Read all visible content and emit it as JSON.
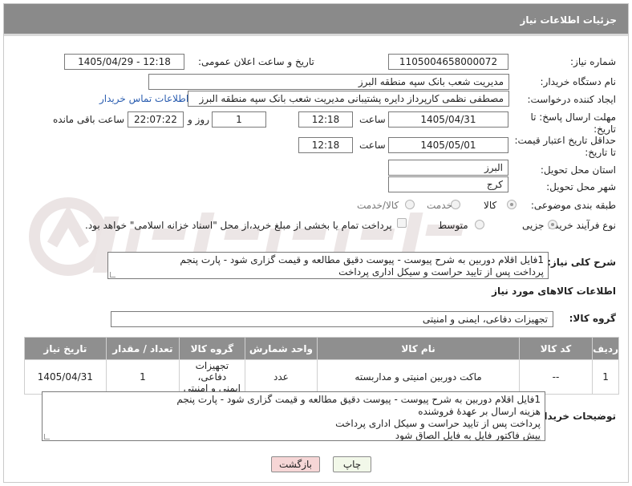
{
  "panel": {
    "title": "جزئیات اطلاعات نیاز"
  },
  "fields": {
    "need_number_label": "شماره نیاز:",
    "need_number": "1105004658000072",
    "announce_label": "تاریخ و ساعت اعلان عمومی:",
    "announce_value": "1405/04/29 - 12:18",
    "buyer_label": "نام دستگاه خریدار:",
    "buyer_value": "مدیریت شعب بانک سپه منطقه البرز",
    "requester_label": "ایجاد کننده درخواست:",
    "requester_value": "مصطفی نظمی کارپرداز دایره پشتیبانی مدیریت شعب بانک سپه منطقه البرز",
    "contact_link": "اطلاعات تماس خریدار",
    "deadline_label": "مهلت ارسال پاسخ: تا تاریخ:",
    "deadline_date": "1405/04/31",
    "time_label": "ساعت",
    "deadline_time": "12:18",
    "days_value": "1",
    "days_label": "روز و",
    "remaining_value": "22:07:22",
    "remaining_label": "ساعت باقی مانده",
    "validity_label": "حداقل تاریخ اعتبار قیمت: تا تاریخ:",
    "validity_date": "1405/05/01",
    "validity_time": "12:18",
    "province_label": "استان محل تحویل:",
    "province_value": "البرز",
    "city_label": "شهر محل تحویل:",
    "city_value": "کرج",
    "category_label": "طبقه بندی موضوعی:",
    "category_options": [
      "کالا",
      "خدمت",
      "کالا/خدمت"
    ],
    "category_selected": "کالا",
    "process_label": "نوع فرآیند خرید :",
    "process_options": [
      "جزیی",
      "متوسط"
    ],
    "process_selected": "جزیی",
    "payment_note": "پرداخت تمام یا بخشی از مبلغ خرید،از محل \"اسناد خزانه اسلامی\" خواهد بود.",
    "summary_label": "شرح کلی نیاز:",
    "summary_line1": "1فایل اقلام دوربین به شرح پیوست - پیوست دقیق مطالعه و قیمت گزاری شود - پارت پنجم",
    "summary_line2": "پرداخت پس از تایید حراست و سیکل اداری پرداخت"
  },
  "goods": {
    "section_title": "اطلاعات کالاهای مورد نیاز",
    "group_label": "گروه کالا:",
    "group_value": "تجهیزات دفاعی، ایمنی و امنیتی",
    "columns": [
      "ردیف",
      "کد کالا",
      "نام کالا",
      "واحد شمارش",
      "گروه کالا",
      "تعداد / مقدار",
      "تاریخ نیاز"
    ],
    "rows": [
      {
        "row": "1",
        "code": "--",
        "name": "ماکت دوربین امنیتی و مداربسته",
        "unit": "عدد",
        "group_line1": "تجهیزات دفاعی،",
        "group_line2": "ایمنی و امنیتی",
        "qty": "1",
        "date": "1405/04/31"
      }
    ]
  },
  "buyer_notes": {
    "label": "توضیحات خریدار:",
    "lines": [
      "1فایل اقلام دوربین به شرح پیوست - پیوست دقیق مطالعه و قیمت گزاری شود - پارت پنجم",
      "هزینه ارسال بر عهدهٔ فروشنده",
      "پرداخت پس از تایید حراست و سیکل اداری پرداخت",
      "پیش فاکتور فایل به فایل الصاق شود"
    ]
  },
  "buttons": {
    "print": "چاپ",
    "back": "بازگشت"
  },
  "colors": {
    "header": "#8a8a8a",
    "link": "#2a5db0",
    "back_button": "#f6d6d6",
    "print_button": "#f2f8e9"
  },
  "watermark": {
    "brand": "AriaTender.neT"
  }
}
